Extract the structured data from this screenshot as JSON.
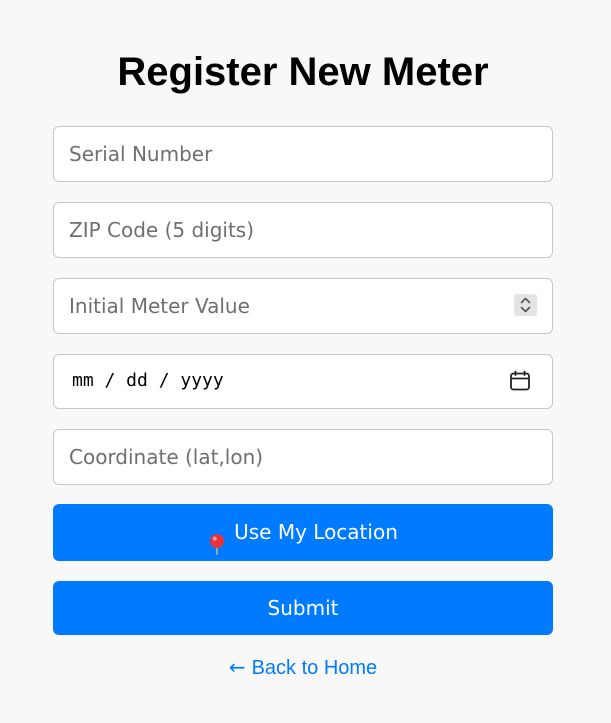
{
  "page": {
    "title": "Register New Meter"
  },
  "form": {
    "serial_number": {
      "placeholder": "Serial Number",
      "value": ""
    },
    "zip_code": {
      "placeholder": "ZIP Code (5 digits)",
      "value": ""
    },
    "initial_value": {
      "placeholder": "Initial Meter Value",
      "value": ""
    },
    "date": {
      "display": "mm / dd / yyyy",
      "value": ""
    },
    "coordinate": {
      "placeholder": "Coordinate (lat,lon)",
      "value": ""
    },
    "use_location_label": "Use My Location",
    "submit_label": "Submit"
  },
  "nav": {
    "back_arrow": "←",
    "back_label": "Back to Home"
  },
  "icons": {
    "location": "pin-icon",
    "calendar": "calendar-icon",
    "spinner": "spinner-arrows-icon"
  },
  "colors": {
    "accent": "#007bff",
    "background": "#f8f8f8",
    "field_border": "#c8c8c8",
    "placeholder": "#6f6f6f"
  }
}
